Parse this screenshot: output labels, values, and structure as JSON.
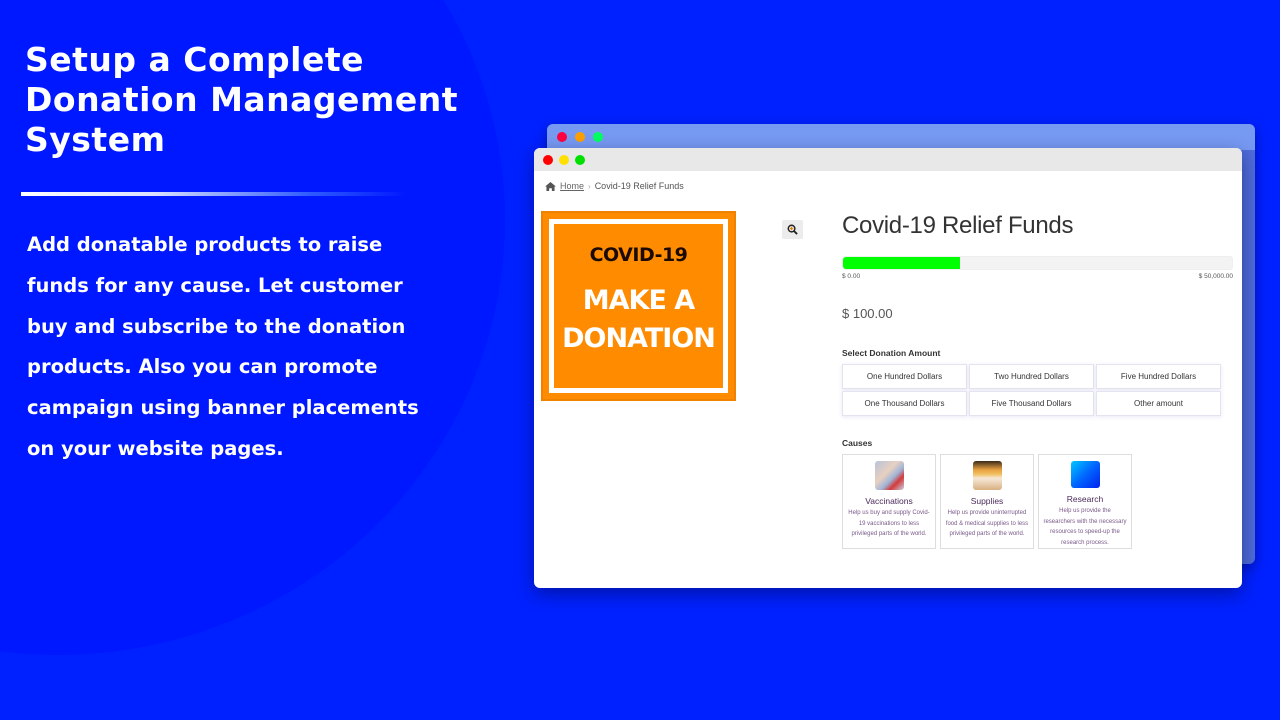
{
  "hero": {
    "title_lines": [
      "Setup a Complete",
      "Donation Management",
      "System"
    ],
    "description_lines": [
      "Add donatable products to raise",
      "funds for any cause. Let customer",
      "buy and subscribe to the donation",
      "products. Also you can promote",
      "campaign using banner placements",
      "on your website pages."
    ]
  },
  "colors": {
    "background": "#0021ff",
    "circle": "#0018ff",
    "accent_orange": "#ff8b00",
    "progress_green": "#00ff00",
    "traffic_close": "#ff0000",
    "traffic_min": "#ffe000",
    "traffic_max": "#00e000",
    "back_close": "#ff0040",
    "back_min": "#ffa000",
    "back_max": "#00ff60"
  },
  "browser": {
    "breadcrumb": {
      "home_icon": "home-icon",
      "home_label": "Home",
      "separator": "›",
      "current": "Covid-19 Relief Funds"
    },
    "product_image": {
      "top_text": "COVID-19",
      "main_line1": "MAKE A",
      "main_line2": "DONATION"
    },
    "zoom_icon": "magnifier-plus-icon",
    "product": {
      "title": "Covid-19 Relief Funds",
      "progress_fraction": 0.3,
      "progress_min_label": "$ 0.00",
      "progress_max_label": "$ 50,000.00",
      "price": "$ 100.00"
    },
    "donation_amount": {
      "label": "Select Donation Amount",
      "options": [
        "One Hundred Dollars",
        "Two Hundred Dollars",
        "Five Hundred Dollars",
        "One Thousand Dollars",
        "Five Thousand Dollars",
        "Other amount"
      ]
    },
    "causes": {
      "label": "Causes",
      "items": [
        {
          "name": "Vaccinations",
          "description": "Help us buy and supply Covid-19 vaccinations to less privileged parts of the world."
        },
        {
          "name": "Supplies",
          "description": "Help us provide uninterrupted food & medical supplies to less privileged parts of the world."
        },
        {
          "name": "Research",
          "description": "Help us provide the researchers with the necessary resources to speed-up the research process."
        }
      ]
    }
  }
}
